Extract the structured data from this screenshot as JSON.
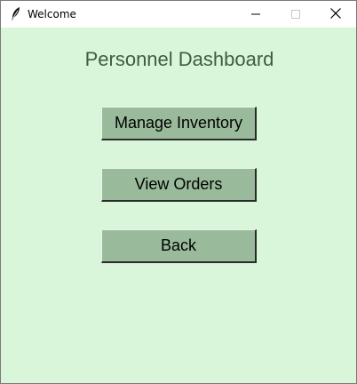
{
  "window": {
    "title": "Welcome",
    "app_icon": "feather-icon",
    "controls": {
      "minimize_icon": "minimize-icon",
      "maximize_icon": "maximize-icon",
      "close_icon": "close-icon"
    }
  },
  "main": {
    "heading": "Personnel Dashboard",
    "buttons": [
      {
        "label": "Manage Inventory"
      },
      {
        "label": "View Orders"
      },
      {
        "label": "Back"
      }
    ]
  },
  "colors": {
    "background": "#d9f5da",
    "button_bg": "#9abb9b",
    "heading_text": "#3e5e3e"
  }
}
